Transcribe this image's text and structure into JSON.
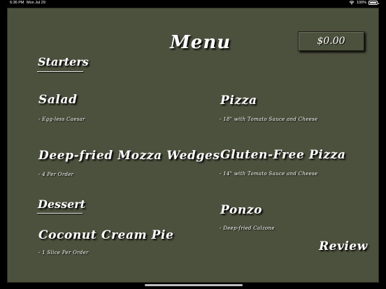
{
  "status_bar": {
    "time": "6:36 PM",
    "date": "Mon Jul 29",
    "battery": "100%",
    "icons": [
      "wifi-icon",
      "battery-icon"
    ]
  },
  "header": {
    "title": "Menu",
    "balance": "$0.00"
  },
  "sections": {
    "starters": {
      "title": "Starters",
      "items": [
        {
          "name": "Salad",
          "description": "- Egg-less Caesar"
        },
        {
          "name": "Deep-fried Mozza Wedges",
          "description": "- 4 Per Order"
        }
      ]
    },
    "dessert": {
      "title": "Dessert",
      "items": [
        {
          "name": "Coconut Cream Pie",
          "description": "- 1 Slice Per Order"
        }
      ]
    },
    "mains": {
      "items": [
        {
          "name": "Pizza",
          "description": "- 18\" with Tomato Sauce and Cheese"
        },
        {
          "name": "Gluten-Free Pizza",
          "description": "- 14\" with Tomato Sauce and Cheese"
        },
        {
          "name": "Ponzo",
          "description": "- Deep-fried Calzone"
        }
      ]
    }
  },
  "actions": {
    "review_label": "Review"
  },
  "colors": {
    "background": "#4c513d",
    "text": "#ffffff"
  }
}
